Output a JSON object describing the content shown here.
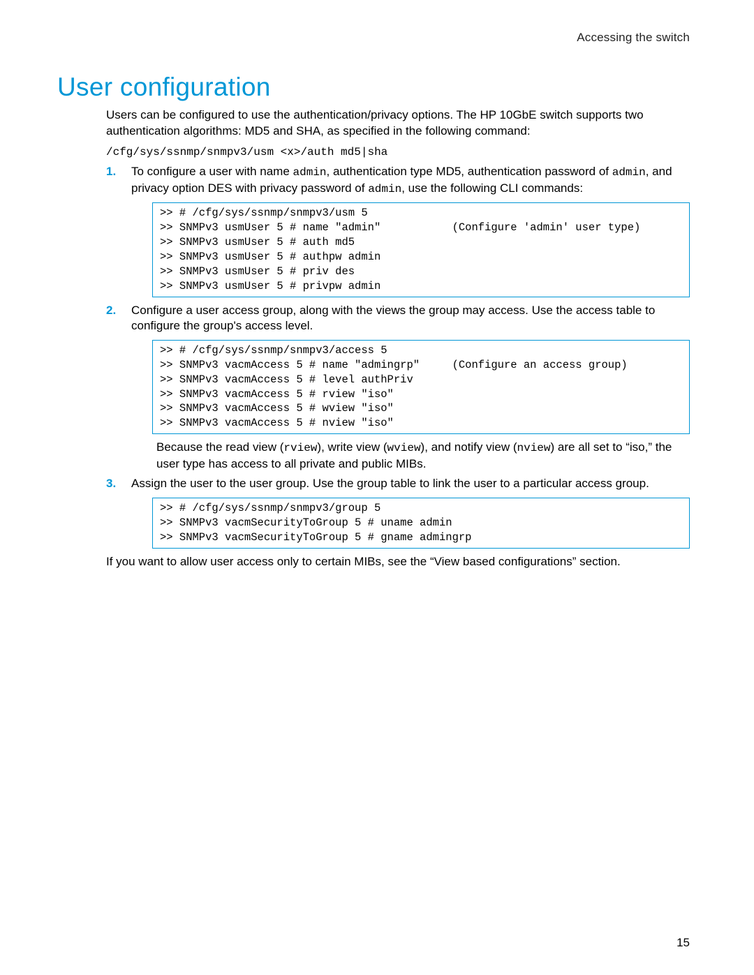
{
  "header": {
    "running_head": "Accessing the switch"
  },
  "title": "User configuration",
  "intro": {
    "para": "Users can be configured to use the authentication/privacy options. The HP 10GbE switch supports two authentication algorithms: MD5 and SHA, as specified in the following command:",
    "command": "/cfg/sys/ssnmp/snmpv3/usm <x>/auth md5|sha"
  },
  "steps": [
    {
      "marker": "1.",
      "text_parts": [
        "To configure a user with name ",
        "admin",
        ", authentication type MD5, authentication password of ",
        "admin",
        ", and privacy option DES with privacy password of ",
        "admin",
        ", use the following CLI commands:"
      ],
      "code": ">> # /cfg/sys/ssnmp/snmpv3/usm 5\n>> SNMPv3 usmUser 5 # name \"admin\"           (Configure 'admin' user type)\n>> SNMPv3 usmUser 5 # auth md5\n>> SNMPv3 usmUser 5 # authpw admin\n>> SNMPv3 usmUser 5 # priv des\n>> SNMPv3 usmUser 5 # privpw admin"
    },
    {
      "marker": "2.",
      "text_parts": [
        "Configure a user access group, along with the views the group may access. Use the access table to configure the group's access level."
      ],
      "code": ">> # /cfg/sys/ssnmp/snmpv3/access 5\n>> SNMPv3 vacmAccess 5 # name \"admingrp\"     (Configure an access group)\n>> SNMPv3 vacmAccess 5 # level authPriv\n>> SNMPv3 vacmAccess 5 # rview \"iso\"\n>> SNMPv3 vacmAccess 5 # wview \"iso\"\n>> SNMPv3 vacmAccess 5 # nview \"iso\"",
      "after_parts": [
        "Because the read view (",
        "rview",
        "), write view (",
        "wview",
        "), and notify view (",
        "nview",
        ") are all set to “iso,” the user type has access to all private and public MIBs."
      ]
    },
    {
      "marker": "3.",
      "text_parts": [
        "Assign the user to the user group. Use the group table to link the user to a particular access group."
      ],
      "code": ">> # /cfg/sys/ssnmp/snmpv3/group 5\n>> SNMPv3 vacmSecurityToGroup 5 # uname admin\n>> SNMPv3 vacmSecurityToGroup 5 # gname admingrp"
    }
  ],
  "closing": "If you want to allow user access only to certain MIBs, see the “View based configurations” section.",
  "page_number": "15"
}
